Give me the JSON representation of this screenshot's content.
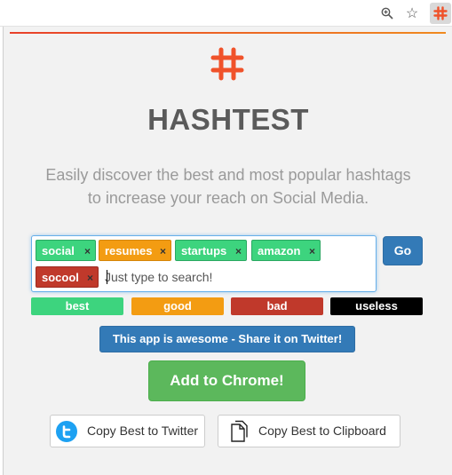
{
  "toolbar": {
    "icons": [
      "zoom-icon",
      "star-icon",
      "hashtest-extension-icon"
    ]
  },
  "app": {
    "title": "HASHTEST",
    "tagline_line1": "Easily discover the best and most popular hashtags",
    "tagline_line2": "to increase your reach on Social Media."
  },
  "tags": [
    {
      "label": "social",
      "quality": "best"
    },
    {
      "label": "resumes",
      "quality": "good"
    },
    {
      "label": "startups",
      "quality": "best"
    },
    {
      "label": "amazon",
      "quality": "best"
    },
    {
      "label": "socool",
      "quality": "bad"
    }
  ],
  "tag_remove": "×",
  "search": {
    "placeholder": "Just type to search!"
  },
  "go_label": "Go",
  "legend": {
    "best": "best",
    "good": "good",
    "bad": "bad",
    "useless": "useless"
  },
  "share_label": "This app is awesome - Share it on Twitter!",
  "add_label": "Add to Chrome!",
  "copy_twitter_label": "Copy Best to Twitter",
  "copy_clipboard_label": "Copy Best to Clipboard",
  "colors": {
    "best": "#3dd47e",
    "good": "#f39c12",
    "bad": "#c0392b",
    "useless": "#000000",
    "primary": "#337ab7",
    "success": "#5cb85c",
    "logo": "#f0522a"
  }
}
